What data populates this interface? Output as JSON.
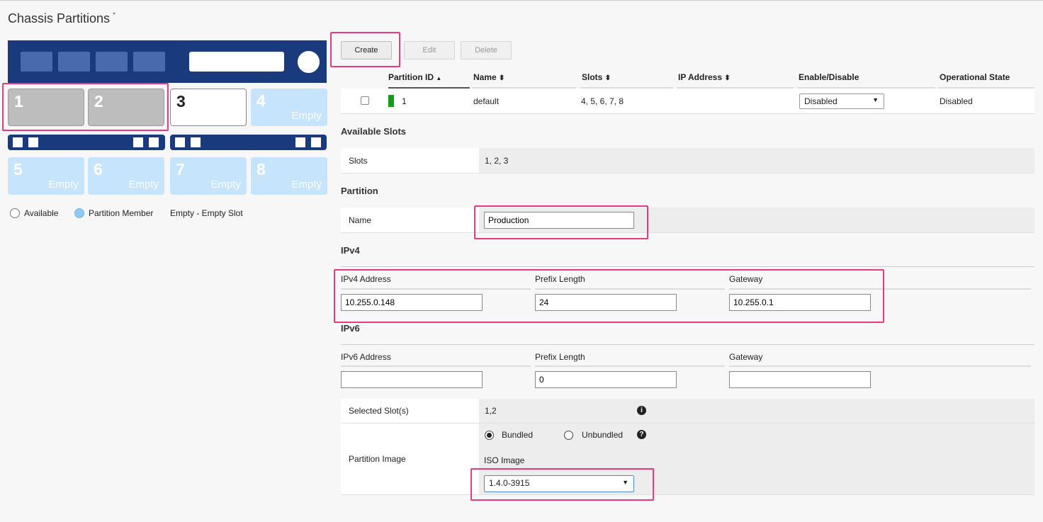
{
  "page": {
    "title": "Chassis Partitions",
    "required_marker": "*"
  },
  "chassis": {
    "top_slots": [
      {
        "num": "1",
        "state": "selected",
        "sub": ""
      },
      {
        "num": "2",
        "state": "selected",
        "sub": ""
      },
      {
        "num": "3",
        "state": "available",
        "sub": ""
      },
      {
        "num": "4",
        "state": "empty",
        "sub": "Empty"
      }
    ],
    "bottom_slots": [
      {
        "num": "5",
        "state": "empty",
        "sub": "Empty"
      },
      {
        "num": "6",
        "state": "empty",
        "sub": "Empty"
      },
      {
        "num": "7",
        "state": "empty",
        "sub": "Empty"
      },
      {
        "num": "8",
        "state": "empty",
        "sub": "Empty"
      }
    ]
  },
  "legend": {
    "available": "Available",
    "member": "Partition Member",
    "empty": "Empty - Empty Slot"
  },
  "toolbar": {
    "create": "Create",
    "edit": "Edit",
    "delete": "Delete"
  },
  "table": {
    "headers": {
      "partition_id": "Partition ID",
      "name": "Name",
      "slots": "Slots",
      "ip": "IP Address",
      "enable": "Enable/Disable",
      "state": "Operational State"
    },
    "sort_asc": "▲",
    "sort_both": "⬍",
    "row": {
      "id": "1",
      "name": "default",
      "slots": "4, 5, 6, 7, 8",
      "ip": "",
      "enable": "Disabled",
      "state": "Disabled",
      "status_color": "#1a9a1a"
    }
  },
  "available_slots": {
    "heading": "Available Slots",
    "label": "Slots",
    "value": "1, 2, 3"
  },
  "partition": {
    "heading": "Partition",
    "name_label": "Name",
    "name_value": "Production"
  },
  "ipv4": {
    "heading": "IPv4",
    "address_label": "IPv4 Address",
    "address": "10.255.0.148",
    "prefix_label": "Prefix Length",
    "prefix": "24",
    "gateway_label": "Gateway",
    "gateway": "10.255.0.1"
  },
  "ipv6": {
    "heading": "IPv6",
    "address_label": "IPv6 Address",
    "address": "",
    "prefix_label": "Prefix Length",
    "prefix": "0",
    "gateway_label": "Gateway",
    "gateway": ""
  },
  "selected_slots": {
    "label": "Selected Slot(s)",
    "value": "1,2"
  },
  "image": {
    "label": "Partition Image",
    "bundled": "Bundled",
    "unbundled": "Unbundled",
    "selected_mode": "Bundled",
    "iso_label": "ISO Image",
    "iso_value": "1.4.0-3915"
  },
  "colors": {
    "chassis": "#1a3a7e",
    "highlight": "#ea3a7e",
    "empty_slot": "#c6e4fb",
    "member_dot": "#8fcaf5"
  }
}
